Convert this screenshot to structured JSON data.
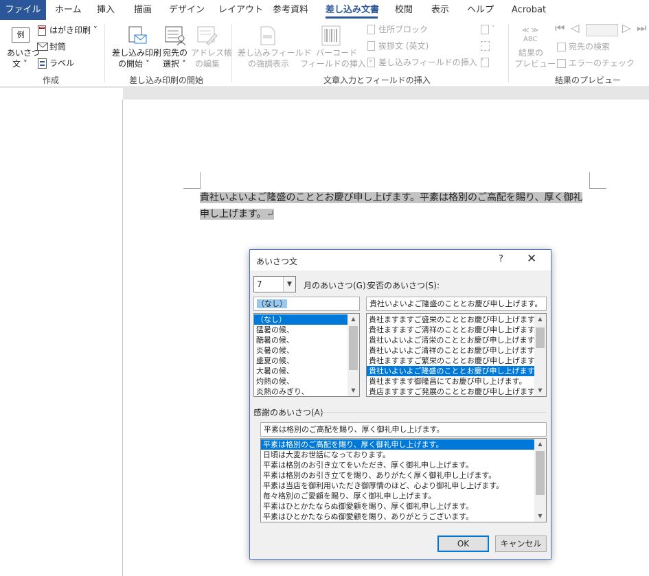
{
  "ribbon_tabs": {
    "file": "ファイル",
    "home": "ホーム",
    "insert": "挿入",
    "draw": "描画",
    "design": "デザイン",
    "layout": "レイアウト",
    "references": "参考資料",
    "mailings": "差し込み文書",
    "review": "校閲",
    "view": "表示",
    "help": "ヘルプ",
    "acrobat": "Acrobat"
  },
  "ribbon": {
    "create": {
      "greeting_btn": [
        "あいさつ",
        "文"
      ],
      "greeting_icon_text": "例",
      "postcard": "はがき印刷",
      "envelope": "封筒",
      "label": "ラベル",
      "group": "作成"
    },
    "start_merge": {
      "start": [
        "差し込み印刷",
        "の開始"
      ],
      "recipients": [
        "宛先の",
        "選択"
      ],
      "edit_list": [
        "アドレス帳",
        "の編集"
      ],
      "group": "差し込み印刷の開始"
    },
    "write_insert": {
      "highlight": [
        "差し込みフィールド",
        "の強調表示"
      ],
      "barcode": [
        "バーコード",
        "フィールドの挿入"
      ],
      "address_block": "住所ブロック",
      "greeting_line": "挨拶文 (英文)",
      "insert_field": "差し込みフィールドの挿入",
      "group": "文章入力とフィールドの挿入"
    },
    "preview": {
      "preview_abc": "ABC",
      "preview_btn": [
        "結果の",
        "プレビュー"
      ],
      "find_recipient": "宛先の検索",
      "check_errors": "エラーのチェック",
      "group": "結果のプレビュー"
    }
  },
  "document": {
    "text": "貴社いよいよご隆盛のこととお慶び申し上げます。平素は格別のご高配を賜り、厚く御礼申し上げます。",
    "para_mark": "↵"
  },
  "dialog": {
    "title": "あいさつ文",
    "help": "?",
    "close": "✕",
    "month_value": "7",
    "month_label": "月のあいさつ(G):",
    "anpi_label": "安否のあいさつ(S):",
    "month_text": "（なし）",
    "month_items": [
      "（なし）",
      "猛暑の候、",
      "酷暑の候、",
      "炎暑の候、",
      "盛夏の候、",
      "大暑の候、",
      "灼熱の候、",
      "炎熱のみぎり、"
    ],
    "anpi_text": "貴社いよいよご隆盛のこととお慶び申し上げます。",
    "anpi_items": [
      "貴社ますますご盛栄のこととお慶び申し上げます。",
      "貴社ますますご清祥のこととお慶び申し上げます。",
      "貴社いよいよご清栄のこととお慶び申し上げます。",
      "貴社いよいよご清祥のこととお慶び申し上げます。",
      "貴社ますますご繁栄のこととお慶び申し上げます。",
      "貴社いよいよご隆盛のこととお慶び申し上げます。",
      "貴社ますます御隆昌にてお慶び申し上げます。",
      "貴店ますますご発展のこととお慶び申し上げます。"
    ],
    "thanks_label": "感謝のあいさつ(A)",
    "thanks_text": "平素は格別のご高配を賜り、厚く御礼申し上げます。",
    "thanks_items": [
      "平素は格別のご高配を賜り、厚く御礼申し上げます。",
      "日頃は大変お世話になっております。",
      "平素は格別のお引き立てをいただき、厚く御礼申し上げます。",
      "平素は格別のお引き立てを賜り、ありがたく厚く御礼申し上げます。",
      "平素は当店を御利用いただき御厚情のほど、心より御礼申し上げます。",
      "毎々格別のご愛顧を賜り、厚く御礼申し上げます。",
      "平素はひとかたならぬ御愛顧を賜り、厚く御礼申し上げます。",
      "平素はひとかたならぬ御愛顧を賜り、ありがとうございます。"
    ],
    "ok": "OK",
    "cancel": "キャンセル"
  },
  "colors": {
    "accent": "#2b579a",
    "selection": "#0078d7"
  }
}
